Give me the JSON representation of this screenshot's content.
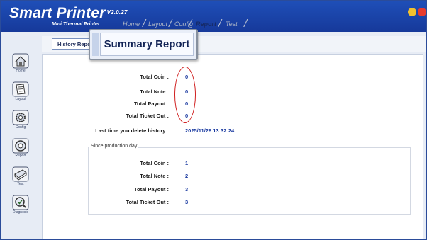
{
  "app": {
    "brand": "Smart Printer",
    "version": "V2.0.27",
    "subtitle": "Mini Thermal Printer"
  },
  "nav": {
    "tabs": [
      {
        "label": "Home"
      },
      {
        "label": "Layout"
      },
      {
        "label": "Config"
      },
      {
        "label": "Report"
      },
      {
        "label": "Test"
      }
    ],
    "active": "Report"
  },
  "sidebar": {
    "items": [
      {
        "label": "Home",
        "icon": "home-icon"
      },
      {
        "label": "Layout",
        "icon": "layout-icon"
      },
      {
        "label": "Config",
        "icon": "gear-icon"
      },
      {
        "label": "Report",
        "icon": "report-icon"
      },
      {
        "label": "Test",
        "icon": "printer-icon"
      },
      {
        "label": "Diagnosis",
        "icon": "diagnosis-icon"
      }
    ]
  },
  "subtabs": {
    "history": "History Report",
    "summary": "Summary Report"
  },
  "summary": {
    "total_coin_label": "Total Coin :",
    "total_coin": "0",
    "total_note_label": "Total Note :",
    "total_note": "0",
    "total_payout_label": "Total Payout :",
    "total_payout": "0",
    "total_ticket_label": "Total Ticket Out :",
    "total_ticket": "0",
    "last_delete_label": "Last time you delete history :",
    "last_delete": "2025/11/28 13:32:24"
  },
  "production": {
    "title": "Since production day",
    "total_coin_label": "Total Coin :",
    "total_coin": "1",
    "total_note_label": "Total Note :",
    "total_note": "2",
    "total_payout_label": "Total Payout :",
    "total_payout": "3",
    "total_ticket_label": "Total Ticket Out :",
    "total_ticket": "3"
  },
  "colors": {
    "titlebar": "#1f4fb8",
    "value_blue": "#1a3aa0",
    "highlight_red": "#d02020"
  }
}
